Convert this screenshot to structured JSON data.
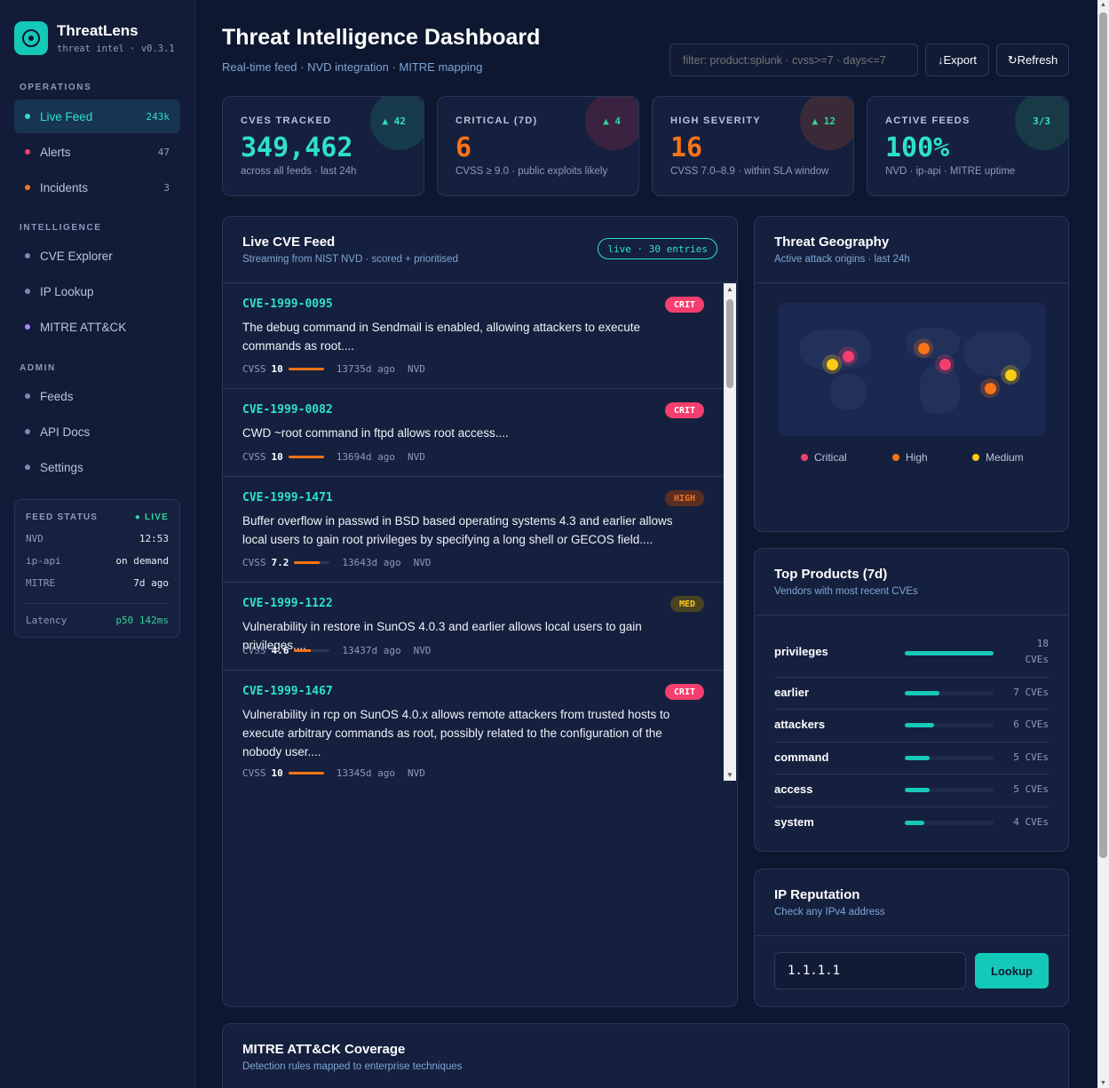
{
  "brand": {
    "name": "ThreatLens",
    "sub": "threat intel · v0.3.1"
  },
  "sidebar": {
    "sections": [
      {
        "title": "OPERATIONS",
        "items": [
          {
            "label": "Live Feed",
            "count": "243k",
            "dot": "#2fe0cc"
          },
          {
            "label": "Alerts",
            "count": "47",
            "dot": "#f43f6e"
          },
          {
            "label": "Incidents",
            "count": "3",
            "dot": "#f97316"
          }
        ]
      },
      {
        "title": "INTELLIGENCE",
        "items": [
          {
            "label": "CVE Explorer",
            "dot": "#7c8ab0"
          },
          {
            "label": "IP Lookup",
            "dot": "#7c8ab0"
          },
          {
            "label": "MITRE ATT&CK",
            "dot": "#a78bfa"
          }
        ]
      },
      {
        "title": "ADMIN",
        "items": [
          {
            "label": "Feeds",
            "dot": "#7c8ab0"
          },
          {
            "label": "API Docs",
            "dot": "#7c8ab0"
          },
          {
            "label": "Settings",
            "dot": "#7c8ab0"
          }
        ]
      }
    ],
    "feed_status": {
      "title": "FEED STATUS",
      "live": "● LIVE",
      "rows": [
        {
          "name": "NVD",
          "value": "12:53"
        },
        {
          "name": "ip-api",
          "value": "on demand"
        },
        {
          "name": "MITRE",
          "value": "7d ago"
        }
      ],
      "latency_label": "Latency",
      "latency_value": "p50 142ms"
    }
  },
  "header": {
    "title": "Threat Intelligence Dashboard",
    "subtitle": "Real-time feed · NVD integration · MITRE mapping",
    "filter_placeholder": "filter: product:splunk · cvss>=7 · days<=7",
    "export_label": "↓Export",
    "refresh_label": "↻Refresh"
  },
  "kpis": [
    {
      "label": "CVES TRACKED",
      "value": "349,462",
      "note": "across all feeds · last 24h",
      "delta": "▲ 42",
      "color": "#2fe0cc",
      "circle": "#173a4c"
    },
    {
      "label": "CRITICAL (7D)",
      "value": "6",
      "note": "CVSS ≥ 9.0 · public exploits likely",
      "delta": "▲ 4",
      "color": "#f97316",
      "circle": "#3a2340"
    },
    {
      "label": "HIGH SEVERITY",
      "value": "16",
      "note": "CVSS 7.0–8.9 · within SLA window",
      "delta": "▲ 12",
      "color": "#f97316",
      "circle": "#3a2a38"
    },
    {
      "label": "ACTIVE FEEDS",
      "value": "100%",
      "note": "NVD · ip-api · MITRE uptime",
      "delta": "3/3",
      "color": "#2fe0cc",
      "circle": "#173a46"
    }
  ],
  "feed": {
    "title": "Live CVE Feed",
    "subtitle": "Streaming from NIST NVD · scored + prioritised",
    "badge": "live · 30 entries",
    "items": [
      {
        "id": "CVE-1999-0095",
        "severity": "CRIT",
        "desc": "The debug command in Sendmail is enabled, allowing attackers to execute commands as root....",
        "cvss_label": "CVSS",
        "cvss": "10",
        "cvss_score": 10,
        "age": "13735d ago",
        "source": "NVD"
      },
      {
        "id": "CVE-1999-0082",
        "severity": "CRIT",
        "desc": "CWD ~root command in ftpd allows root access....",
        "cvss_label": "CVSS",
        "cvss": "10",
        "cvss_score": 10,
        "age": "13694d ago",
        "source": "NVD"
      },
      {
        "id": "CVE-1999-1471",
        "severity": "HIGH",
        "desc": "Buffer overflow in passwd in BSD based operating systems 4.3 and earlier allows local users to gain root privileges by specifying a long shell or GECOS field....",
        "cvss_label": "CVSS",
        "cvss": "7.2",
        "cvss_score": 7.2,
        "age": "13643d ago",
        "source": "NVD"
      },
      {
        "id": "CVE-1999-1122",
        "severity": "MED",
        "desc": "Vulnerability in restore in SunOS 4.0.3 and earlier allows local users to gain privileges....",
        "cvss_label": "CVSS",
        "cvss": "4.6",
        "cvss_score": 4.6,
        "age": "13437d ago",
        "source": "NVD"
      },
      {
        "id": "CVE-1999-1467",
        "severity": "CRIT",
        "desc": "Vulnerability in rcp on SunOS 4.0.x allows remote attackers from trusted hosts to execute arbitrary commands as root, possibly related to the configuration of the nobody user....",
        "cvss_label": "CVSS",
        "cvss": "10",
        "cvss_score": 10,
        "age": "13345d ago",
        "source": "NVD"
      }
    ]
  },
  "geo": {
    "title": "Threat Geography",
    "subtitle": "Active attack origins · last 24h",
    "legend": [
      {
        "label": "Critical",
        "color": "#f43f6e"
      },
      {
        "label": "High",
        "color": "#f97316"
      },
      {
        "label": "Medium",
        "color": "#facc15"
      }
    ]
  },
  "products": {
    "title": "Top Products (7d)",
    "subtitle": "Vendors with most recent CVEs",
    "items": [
      {
        "name": "privileges",
        "count": "18",
        "unit": "CVEs",
        "value": 18
      },
      {
        "name": "earlier",
        "count": "7",
        "unit": "CVEs",
        "value": 7
      },
      {
        "name": "attackers",
        "count": "6",
        "unit": "CVEs",
        "value": 6
      },
      {
        "name": "command",
        "count": "5",
        "unit": "CVEs",
        "value": 5
      },
      {
        "name": "access",
        "count": "5",
        "unit": "CVEs",
        "value": 5
      },
      {
        "name": "system",
        "count": "4",
        "unit": "CVEs",
        "value": 4
      }
    ]
  },
  "ip": {
    "title": "IP Reputation",
    "subtitle": "Check any IPv4 address",
    "value": "1.1.1.1",
    "button": "Lookup"
  },
  "mitre": {
    "title": "MITRE ATT&CK Coverage",
    "subtitle": "Detection rules mapped to enterprise techniques"
  }
}
